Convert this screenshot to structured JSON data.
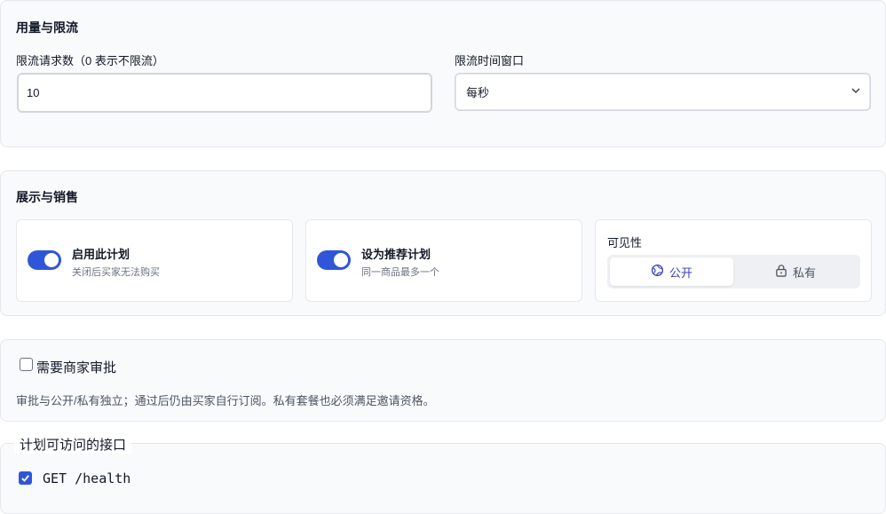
{
  "usage": {
    "title": "用量与限流",
    "rate_limit_label": "限流请求数（0 表示不限流）",
    "rate_limit_value": "10",
    "window_label": "限流时间窗口",
    "window_value": "每秒"
  },
  "display": {
    "title": "展示与销售",
    "enable": {
      "title": "启用此计划",
      "desc": "关闭后买家无法购买"
    },
    "featured": {
      "title": "设为推荐计划",
      "desc": "同一商品最多一个"
    },
    "visibility": {
      "label": "可见性",
      "options": [
        "公开",
        "私有"
      ],
      "selected": "公开"
    }
  },
  "approval": {
    "label": "需要商家审批",
    "note": "审批与公开/私有独立；通过后仍由买家自行订阅。私有套餐也必须满足邀请资格。"
  },
  "endpoints": {
    "legend": "计划可访问的接口",
    "items": [
      "GET /health"
    ]
  },
  "colors": {
    "accent": "#2f56d9",
    "segment_active_text": "#3b3fb8"
  }
}
